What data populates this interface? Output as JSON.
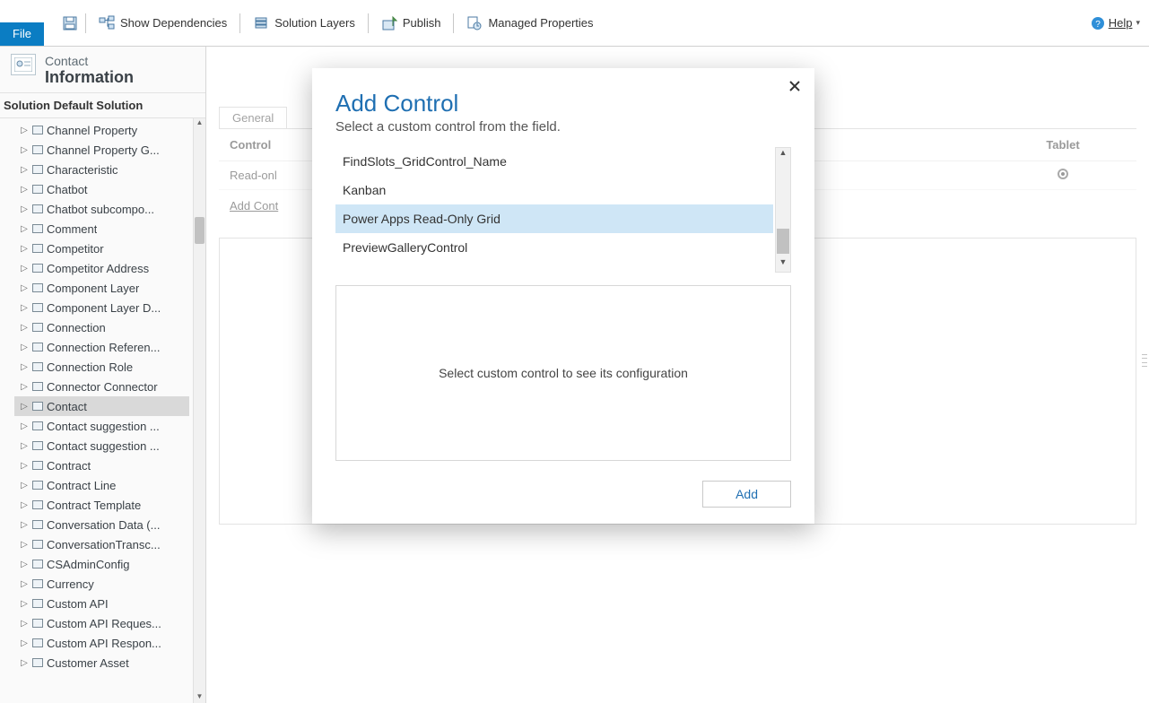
{
  "toolbar": {
    "file": "File",
    "show_dependencies": "Show Dependencies",
    "solution_layers": "Solution Layers",
    "publish": "Publish",
    "managed_properties": "Managed Properties",
    "help": "Help"
  },
  "header": {
    "entity": "Contact",
    "form": "Information",
    "solution_label": "Solution Default Solution"
  },
  "tree": {
    "items": [
      {
        "label": "Channel Property",
        "selected": false
      },
      {
        "label": "Channel Property G...",
        "selected": false
      },
      {
        "label": "Characteristic",
        "selected": false
      },
      {
        "label": "Chatbot",
        "selected": false
      },
      {
        "label": "Chatbot subcompo...",
        "selected": false
      },
      {
        "label": "Comment",
        "selected": false
      },
      {
        "label": "Competitor",
        "selected": false
      },
      {
        "label": "Competitor Address",
        "selected": false
      },
      {
        "label": "Component Layer",
        "selected": false
      },
      {
        "label": "Component Layer D...",
        "selected": false
      },
      {
        "label": "Connection",
        "selected": false
      },
      {
        "label": "Connection Referen...",
        "selected": false
      },
      {
        "label": "Connection Role",
        "selected": false
      },
      {
        "label": "Connector Connector",
        "selected": false
      },
      {
        "label": "Contact",
        "selected": true
      },
      {
        "label": "Contact suggestion ...",
        "selected": false
      },
      {
        "label": "Contact suggestion ...",
        "selected": false
      },
      {
        "label": "Contract",
        "selected": false
      },
      {
        "label": "Contract Line",
        "selected": false
      },
      {
        "label": "Contract Template",
        "selected": false
      },
      {
        "label": "Conversation Data (...",
        "selected": false
      },
      {
        "label": "ConversationTransc...",
        "selected": false
      },
      {
        "label": "CSAdminConfig",
        "selected": false
      },
      {
        "label": "Currency",
        "selected": false
      },
      {
        "label": "Custom API",
        "selected": false
      },
      {
        "label": "Custom API Reques...",
        "selected": false
      },
      {
        "label": "Custom API Respon...",
        "selected": false
      },
      {
        "label": "Customer Asset",
        "selected": false
      }
    ]
  },
  "main": {
    "tab_general": "General",
    "col_control": "Control",
    "col_tablet": "Tablet",
    "row_label": "Read-onl",
    "add_control_link": "Add Cont"
  },
  "dialog": {
    "title": "Add Control",
    "subtitle": "Select a custom control from the field.",
    "items": [
      {
        "label": "FindSlots_GridControl_Name",
        "active": false
      },
      {
        "label": "Kanban",
        "active": false
      },
      {
        "label": "Power Apps Read-Only Grid",
        "active": true
      },
      {
        "label": "PreviewGalleryControl",
        "active": false
      }
    ],
    "cfg_placeholder": "Select custom control to see its configuration",
    "add_button": "Add"
  }
}
